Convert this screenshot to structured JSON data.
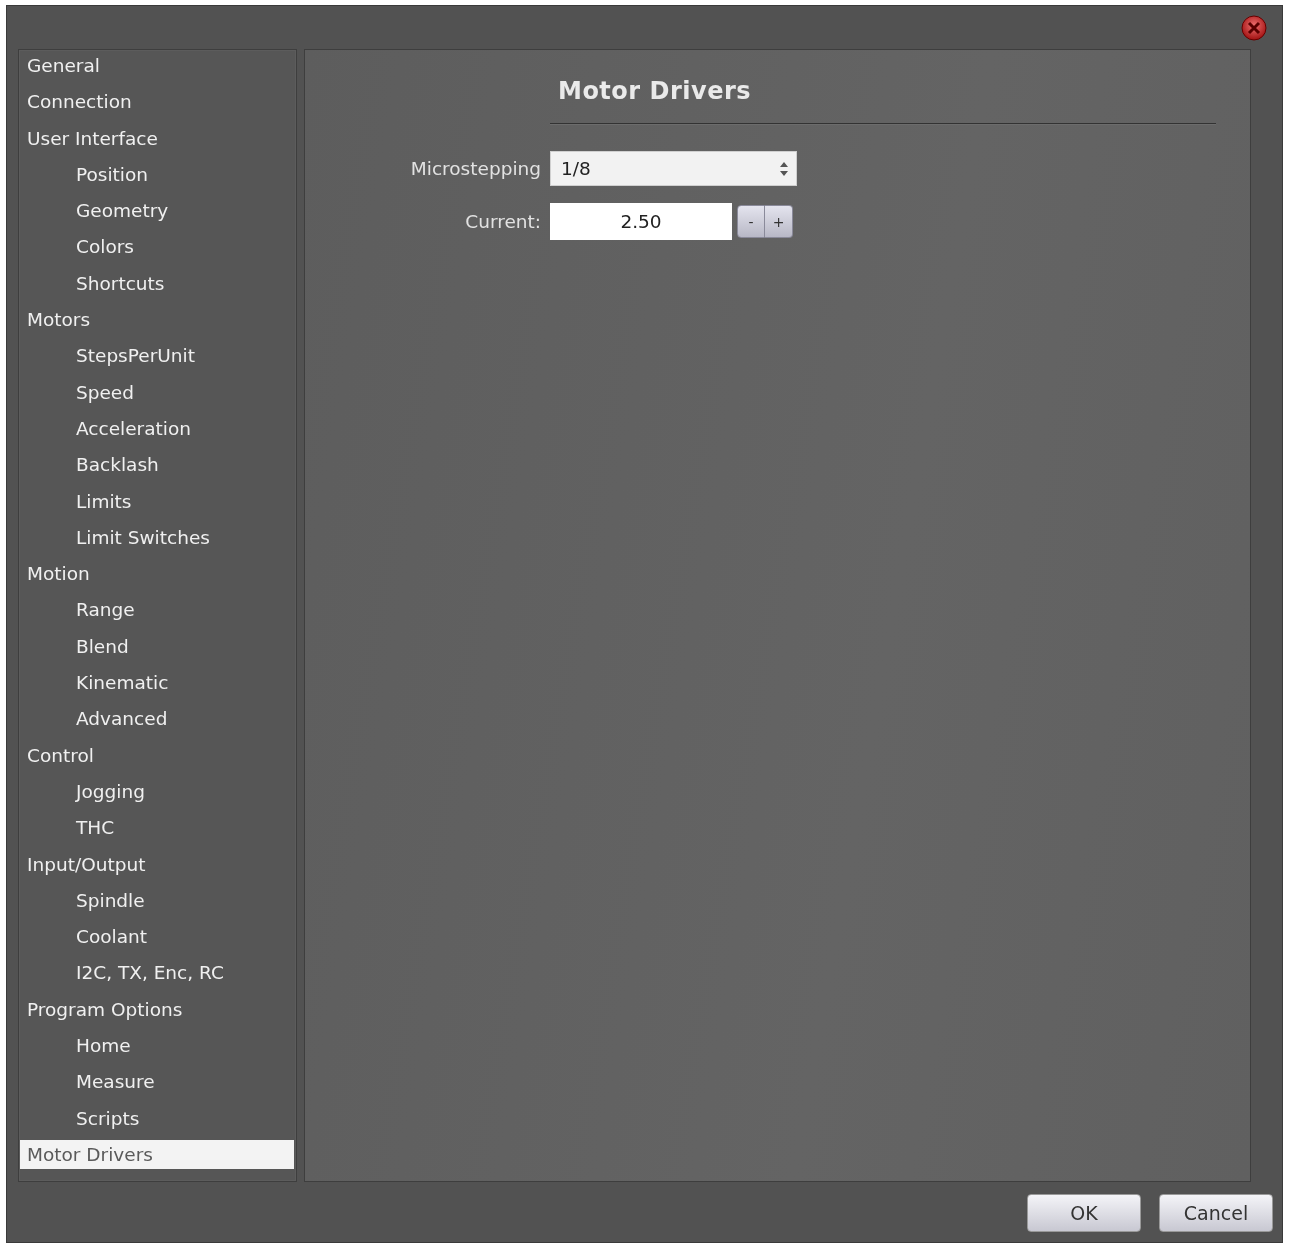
{
  "sidebar": {
    "items": [
      {
        "label": "General",
        "selected": false
      },
      {
        "label": "Connection",
        "selected": false
      },
      {
        "label": "User Interface",
        "selected": false,
        "children": [
          {
            "label": "Position",
            "selected": false
          },
          {
            "label": "Geometry",
            "selected": false
          },
          {
            "label": "Colors",
            "selected": false
          },
          {
            "label": "Shortcuts",
            "selected": false
          }
        ]
      },
      {
        "label": "Motors",
        "selected": false,
        "children": [
          {
            "label": "StepsPerUnit",
            "selected": false
          },
          {
            "label": "Speed",
            "selected": false
          },
          {
            "label": "Acceleration",
            "selected": false
          },
          {
            "label": "Backlash",
            "selected": false
          },
          {
            "label": "Limits",
            "selected": false
          },
          {
            "label": "Limit Switches",
            "selected": false
          }
        ]
      },
      {
        "label": "Motion",
        "selected": false,
        "children": [
          {
            "label": "Range",
            "selected": false
          },
          {
            "label": "Blend",
            "selected": false
          },
          {
            "label": "Kinematic",
            "selected": false
          },
          {
            "label": "Advanced",
            "selected": false
          }
        ]
      },
      {
        "label": "Control",
        "selected": false,
        "children": [
          {
            "label": "Jogging",
            "selected": false
          },
          {
            "label": "THC",
            "selected": false
          }
        ]
      },
      {
        "label": "Input/Output",
        "selected": false,
        "children": [
          {
            "label": "Spindle",
            "selected": false
          },
          {
            "label": "Coolant",
            "selected": false
          },
          {
            "label": "I2C, TX, Enc, RC",
            "selected": false
          }
        ]
      },
      {
        "label": "Program Options",
        "selected": false,
        "children": [
          {
            "label": "Home",
            "selected": false
          },
          {
            "label": "Measure",
            "selected": false
          },
          {
            "label": "Scripts",
            "selected": false
          }
        ]
      },
      {
        "label": "Motor Drivers",
        "selected": true
      }
    ]
  },
  "panel": {
    "title": "Motor Drivers",
    "fields": [
      {
        "kind": "select",
        "label": "Microstepping",
        "value": "1/8"
      },
      {
        "kind": "spin",
        "label": "Current:",
        "value": "2.50",
        "decrement": "-",
        "increment": "+"
      }
    ]
  },
  "buttons": [
    "OK",
    "Cancel"
  ]
}
